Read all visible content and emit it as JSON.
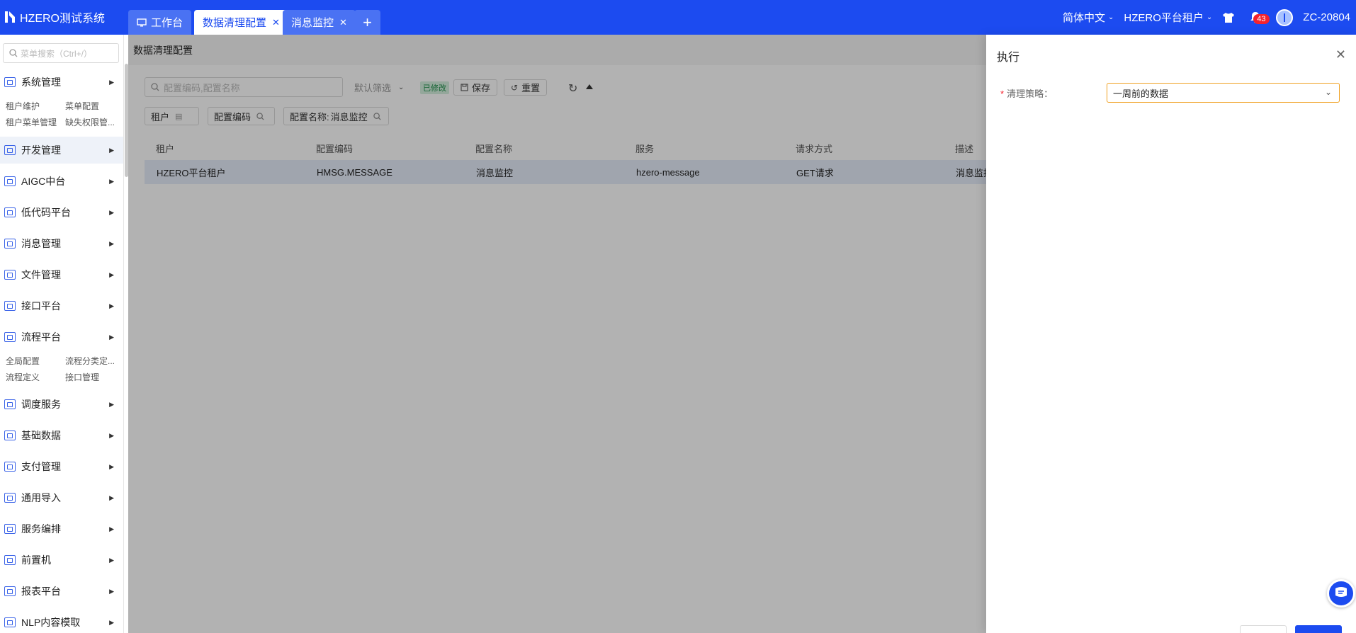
{
  "app": {
    "title": "HZERO测试系统"
  },
  "tabs": [
    {
      "label": "工作台"
    },
    {
      "label": "数据清理配置"
    },
    {
      "label": "消息监控"
    }
  ],
  "header": {
    "language": "简体中文",
    "tenant": "HZERO平台租户",
    "notification_count": "43",
    "user": "ZC-20804"
  },
  "sidebar": {
    "search_placeholder": "菜单搜索（Ctrl+/）",
    "menus": [
      {
        "label": "系统管理"
      },
      {
        "label": "开发管理"
      },
      {
        "label": "AIGC中台"
      },
      {
        "label": "低代码平台"
      },
      {
        "label": "消息管理"
      },
      {
        "label": "文件管理"
      },
      {
        "label": "接口平台"
      },
      {
        "label": "流程平台"
      },
      {
        "label": "调度服务"
      },
      {
        "label": "基础数据"
      },
      {
        "label": "支付管理"
      },
      {
        "label": "通用导入"
      },
      {
        "label": "服务编排"
      },
      {
        "label": "前置机"
      },
      {
        "label": "报表平台"
      },
      {
        "label": "NLP内容模取"
      }
    ],
    "system_sub": [
      "租户维护",
      "菜单配置",
      "租户菜单管理",
      "缺失权限管..."
    ],
    "flow_sub": [
      "全局配置",
      "流程分类定...",
      "流程定义",
      "接口管理"
    ]
  },
  "page": {
    "title": "数据清理配置",
    "search_placeholder": "配置编码,配置名称",
    "filter_label": "默认筛选",
    "modified_tag": "已修改",
    "save_label": "保存",
    "reset_label": "重置",
    "chips": [
      {
        "label": "租户",
        "value": ""
      },
      {
        "label": "配置编码",
        "value": ""
      },
      {
        "label": "配置名称:",
        "value": "消息监控"
      }
    ],
    "columns": [
      "租户",
      "配置编码",
      "配置名称",
      "服务",
      "请求方式",
      "描述"
    ],
    "rows": [
      [
        "HZERO平台租户",
        "HMSG.MESSAGE",
        "消息监控",
        "hzero-message",
        "GET请求",
        "消息监控"
      ]
    ]
  },
  "drawer": {
    "title": "执行",
    "field_label": "清理策略",
    "field_value": "一周前的数据"
  }
}
